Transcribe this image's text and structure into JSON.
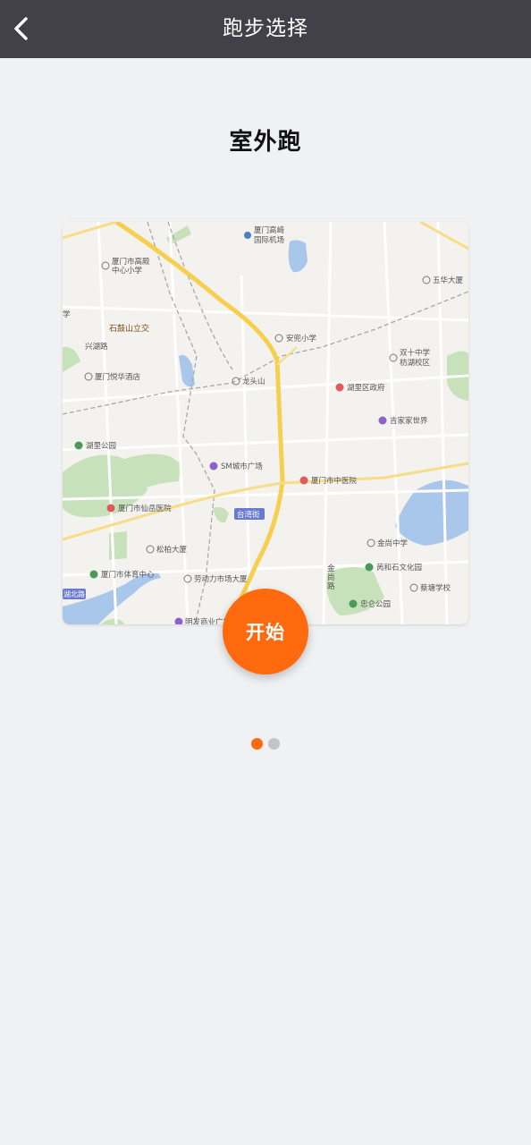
{
  "header": {
    "title": "跑步选择",
    "back_icon": "chevron-left-icon"
  },
  "mode": {
    "title": "室外跑"
  },
  "map": {
    "labels": {
      "airport": "厦门高崎国际机场",
      "airport_line1": "厦门高崎",
      "airport_line2": "国际机场",
      "school_gaoqi_line1": "厦门市高殿",
      "school_gaoqi_line2": "中心小学",
      "wuhua": "五华大厦",
      "xue": "学",
      "shigu": "石鼓山立交",
      "xinghu": "兴湖路",
      "anjian": "安兜小学",
      "shuangshi_line1": "双十中学",
      "shuangshi_line2": "枋湖校区",
      "yuehua": "厦门悦华酒店",
      "longtou": "龙头山",
      "huli_gov": "湖里区政府",
      "jiajia": "吉家家世界",
      "huli_park": "湖里公园",
      "sm": "SM城市广场",
      "tcm": "厦门市中医院",
      "xianyue": "厦门市仙岳医院",
      "taiwan": "台湾街",
      "songbai": "松柏大厦",
      "jinshang": "金尚中学",
      "sports": "厦门市体育中心",
      "labor": "劳动力市场大厦",
      "jin_road_1": "金",
      "jin_road_2": "尚",
      "jin_road_3": "路",
      "pinghe": "苪和石文化园",
      "caitang": "蔡塘学校",
      "zhongren": "忠仑公园",
      "beilu": "湖北路",
      "mall": "明发商业广场"
    }
  },
  "start_button": {
    "label": "开始"
  },
  "pager": {
    "count": 2,
    "active_index": 0,
    "active_color": "#ff6a0e",
    "inactive_color": "#c4c4c4"
  },
  "colors": {
    "header_bg": "#424049",
    "page_bg": "#f0f1f3",
    "accent": "#ff6a0e"
  }
}
